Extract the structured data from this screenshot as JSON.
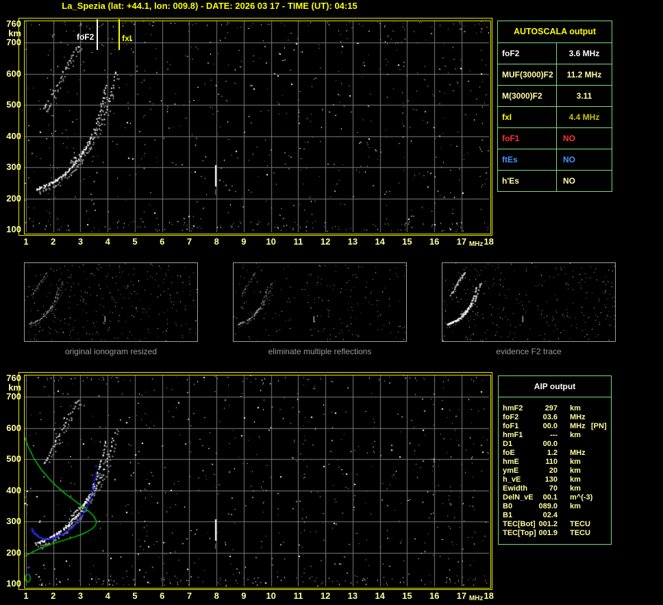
{
  "header": {
    "title": "La_Spezia (lat: +44.1, lon: 009.8) - DATE: 2026 03 17 - TIME (UT): 04:15"
  },
  "autoscala": {
    "title": "AUTOSCALA output",
    "border_color": "#7ede7e",
    "rows": [
      {
        "label": "foF2",
        "value": "3.6 MHz",
        "label_color": "#ffffff",
        "value_color": "#ffffff",
        "value_align": "center"
      },
      {
        "label": "MUF(3000)F2",
        "value": "11.2 MHz",
        "label_color": "#ffffa0",
        "value_color": "#ffffa0",
        "value_align": "center"
      },
      {
        "label": "M(3000)F2",
        "value": "3.11",
        "label_color": "#ffffa0",
        "value_color": "#ffffa0",
        "value_align": "center"
      },
      {
        "label": "fxI",
        "value": "4.4 MHz",
        "label_color": "#ffff00",
        "value_color": "#c9c400",
        "value_align": "center"
      },
      {
        "label": "foF1",
        "value": "NO",
        "label_color": "#ff3232",
        "value_color": "#ff3232",
        "value_align": "left"
      },
      {
        "label": "ftEs",
        "value": "NO",
        "label_color": "#4795ff",
        "value_color": "#4795ff",
        "value_align": "left"
      },
      {
        "label": "h'Es",
        "value": "NO",
        "label_color": "#ffffa0",
        "value_color": "#ffffa0",
        "value_align": "left"
      }
    ]
  },
  "aip": {
    "title": "AIP output",
    "text_color": "#ffffa0",
    "rows": [
      {
        "name": "hmF2",
        "value": "297",
        "unit": "km",
        "note": ""
      },
      {
        "name": "foF2",
        "value": "03.6",
        "unit": "MHz",
        "note": ""
      },
      {
        "name": "foF1",
        "value": "00.0",
        "unit": "MHz",
        "note": "[PN]"
      },
      {
        "name": "hmF1",
        "value": "---",
        "unit": "km",
        "note": ""
      },
      {
        "name": "D1",
        "value": "00.0",
        "unit": "",
        "note": ""
      },
      {
        "name": "foE",
        "value": "1.2",
        "unit": "MHz",
        "note": ""
      },
      {
        "name": "hmE",
        "value": "110",
        "unit": "km",
        "note": ""
      },
      {
        "name": "ymE",
        "value": "20",
        "unit": "km",
        "note": ""
      },
      {
        "name": "h_vE",
        "value": "130",
        "unit": "km",
        "note": ""
      },
      {
        "name": "Ewidth",
        "value": "70",
        "unit": "km",
        "note": ""
      },
      {
        "name": "DelN_vE",
        "value": "00.1",
        "unit": "m^(-3)",
        "note": ""
      },
      {
        "name": "B0",
        "value": "089.0",
        "unit": "km",
        "note": ""
      },
      {
        "name": "B1",
        "value": "02.4",
        "unit": "",
        "note": ""
      },
      {
        "name": "TEC[Bot]",
        "value": "001.2",
        "unit": "TECU",
        "note": ""
      },
      {
        "name": "TEC[Top]",
        "value": "001.9",
        "unit": "TECU",
        "note": ""
      }
    ]
  },
  "thumbnails": [
    {
      "caption": "original ionogram resized"
    },
    {
      "caption": "eliminate multiple reflections"
    },
    {
      "caption": "evidence F2 trace"
    }
  ],
  "chart_data": [
    {
      "id": "top_ionogram",
      "type": "scatter",
      "xlabel": "MHz",
      "ylabel": "km",
      "xlim": [
        1,
        18
      ],
      "ylim": [
        100,
        760
      ],
      "grid": true,
      "xticks": [
        1,
        2,
        3,
        4,
        5,
        6,
        7,
        8,
        9,
        10,
        11,
        12,
        13,
        14,
        15,
        16,
        17,
        18
      ],
      "yticks": [
        760,
        700,
        600,
        500,
        400,
        300,
        200,
        100
      ],
      "markers": [
        {
          "label": "foF2",
          "freq_mhz": 3.6,
          "color": "#ffffff",
          "label_side": "left"
        },
        {
          "label": "fxI",
          "freq_mhz": 4.4,
          "color": "#ffff00",
          "label_side": "right"
        }
      ],
      "series": [
        {
          "name": "F2-trace-ordinary",
          "style": "trace",
          "color": "#ffffff",
          "points": [
            [
              1.35,
              230
            ],
            [
              1.45,
              234
            ],
            [
              1.55,
              237
            ],
            [
              1.65,
              240
            ],
            [
              1.75,
              244
            ],
            [
              1.85,
              248
            ],
            [
              1.95,
              253
            ],
            [
              2.05,
              258
            ],
            [
              2.15,
              263
            ],
            [
              2.25,
              269
            ],
            [
              2.35,
              276
            ],
            [
              2.45,
              283
            ],
            [
              2.55,
              291
            ],
            [
              2.65,
              300
            ],
            [
              2.75,
              310
            ],
            [
              2.85,
              320
            ],
            [
              2.95,
              332
            ],
            [
              3.05,
              345
            ],
            [
              3.15,
              359
            ],
            [
              3.25,
              375
            ],
            [
              3.35,
              393
            ],
            [
              3.45,
              414
            ],
            [
              3.55,
              438
            ],
            [
              3.65,
              466
            ],
            [
              3.75,
              498
            ],
            [
              3.85,
              534
            ],
            [
              3.92,
              565
            ]
          ]
        },
        {
          "name": "F2-trace-extraordinary",
          "style": "trace",
          "color": "#e8e8e8",
          "points": [
            [
              2.6,
              318
            ],
            [
              2.8,
              332
            ],
            [
              3.0,
              348
            ],
            [
              3.2,
              367
            ],
            [
              3.4,
              390
            ],
            [
              3.6,
              418
            ],
            [
              3.8,
              452
            ],
            [
              3.95,
              490
            ],
            [
              4.1,
              532
            ],
            [
              4.2,
              575
            ],
            [
              4.3,
              612
            ]
          ]
        },
        {
          "name": "F2-second-hop",
          "style": "trace",
          "color": "#d8d8d8",
          "points": [
            [
              1.65,
              488
            ],
            [
              1.8,
              512
            ],
            [
              1.95,
              538
            ],
            [
              2.1,
              564
            ],
            [
              2.25,
              590
            ],
            [
              2.4,
              616
            ],
            [
              2.55,
              641
            ],
            [
              2.7,
              663
            ],
            [
              2.82,
              680
            ],
            [
              2.92,
              694
            ]
          ]
        },
        {
          "name": "interference-streak",
          "style": "vline",
          "color": "#ffffff",
          "points": [
            [
              7.95,
              238
            ],
            [
              7.95,
              307
            ]
          ]
        }
      ],
      "noise": {
        "seed": 11,
        "gray": 430,
        "white": 150,
        "top_band": 55,
        "bottom_band": 110,
        "columns": 7
      }
    },
    {
      "id": "bottom_ionogram",
      "type": "scatter",
      "xlabel": "MHz",
      "ylabel": "km",
      "xlim": [
        1,
        18
      ],
      "ylim": [
        100,
        760
      ],
      "grid": true,
      "xticks": [
        1,
        2,
        3,
        4,
        5,
        6,
        7,
        8,
        9,
        10,
        11,
        12,
        13,
        14,
        15,
        16,
        17,
        18
      ],
      "yticks": [
        760,
        700,
        600,
        500,
        400,
        300,
        200,
        100
      ],
      "markers": [],
      "series": [
        {
          "name": "F2-trace-ordinary",
          "style": "trace",
          "color": "#ffffff",
          "points": [
            [
              1.35,
              230
            ],
            [
              1.45,
              234
            ],
            [
              1.55,
              237
            ],
            [
              1.65,
              240
            ],
            [
              1.75,
              244
            ],
            [
              1.85,
              248
            ],
            [
              1.95,
              253
            ],
            [
              2.05,
              258
            ],
            [
              2.15,
              263
            ],
            [
              2.25,
              269
            ],
            [
              2.35,
              276
            ],
            [
              2.45,
              283
            ],
            [
              2.55,
              291
            ],
            [
              2.65,
              300
            ],
            [
              2.75,
              310
            ],
            [
              2.85,
              320
            ],
            [
              2.95,
              332
            ],
            [
              3.05,
              345
            ],
            [
              3.15,
              359
            ],
            [
              3.25,
              375
            ],
            [
              3.35,
              393
            ],
            [
              3.45,
              414
            ],
            [
              3.55,
              438
            ],
            [
              3.65,
              466
            ],
            [
              3.75,
              498
            ],
            [
              3.85,
              534
            ],
            [
              3.92,
              565
            ]
          ]
        },
        {
          "name": "F2-trace-extraordinary",
          "style": "trace",
          "color": "#e8e8e8",
          "points": [
            [
              2.6,
              318
            ],
            [
              2.8,
              332
            ],
            [
              3.0,
              348
            ],
            [
              3.2,
              367
            ],
            [
              3.4,
              390
            ],
            [
              3.6,
              418
            ],
            [
              3.8,
              452
            ],
            [
              3.95,
              490
            ],
            [
              4.1,
              532
            ],
            [
              4.2,
              575
            ],
            [
              4.3,
              612
            ]
          ]
        },
        {
          "name": "F2-second-hop",
          "style": "trace",
          "color": "#d8d8d8",
          "points": [
            [
              1.65,
              488
            ],
            [
              1.8,
              512
            ],
            [
              1.95,
              538
            ],
            [
              2.1,
              564
            ],
            [
              2.25,
              590
            ],
            [
              2.4,
              616
            ],
            [
              2.55,
              641
            ],
            [
              2.7,
              663
            ],
            [
              2.82,
              680
            ],
            [
              2.92,
              694
            ]
          ]
        },
        {
          "name": "interference-streak",
          "style": "vline",
          "color": "#ffffff",
          "points": [
            [
              7.95,
              238
            ],
            [
              7.95,
              307
            ]
          ]
        },
        {
          "name": "model-electron-density-profile",
          "style": "line",
          "color": "#00cc00",
          "points": [
            [
              0.95,
              570
            ],
            [
              1.1,
              536
            ],
            [
              1.3,
              501
            ],
            [
              1.55,
              468
            ],
            [
              1.85,
              437
            ],
            [
              2.15,
              411
            ],
            [
              2.45,
              389
            ],
            [
              2.75,
              369
            ],
            [
              3.05,
              350
            ],
            [
              3.3,
              333
            ],
            [
              3.48,
              318
            ],
            [
              3.6,
              299
            ],
            [
              3.54,
              286
            ],
            [
              3.42,
              276
            ],
            [
              3.25,
              267
            ],
            [
              3.05,
              259
            ],
            [
              2.8,
              251
            ],
            [
              2.55,
              244
            ],
            [
              2.25,
              236
            ],
            [
              1.95,
              228
            ],
            [
              1.65,
              218
            ],
            [
              1.4,
              209
            ],
            [
              1.2,
              200
            ],
            [
              1.05,
              193
            ],
            [
              0.95,
              188
            ]
          ]
        },
        {
          "name": "model-E-layer-loop",
          "style": "ellipse",
          "color": "#00cc00",
          "center": [
            1.06,
            118
          ],
          "rx": 0.1,
          "ry": 12,
          "points": []
        },
        {
          "name": "restored-F2-trace",
          "style": "dots",
          "color": "#2a2aee",
          "points": [
            [
              1.18,
              278
            ],
            [
              1.25,
              268
            ],
            [
              1.33,
              260
            ],
            [
              1.42,
              254
            ],
            [
              1.52,
              249
            ],
            [
              1.63,
              246
            ],
            [
              1.75,
              245
            ],
            [
              1.87,
              246
            ],
            [
              2.0,
              249
            ],
            [
              2.12,
              253
            ],
            [
              2.25,
              258
            ],
            [
              2.38,
              264
            ],
            [
              2.52,
              272
            ],
            [
              2.65,
              281
            ],
            [
              2.78,
              292
            ],
            [
              2.9,
              304
            ],
            [
              3.02,
              318
            ],
            [
              3.12,
              333
            ],
            [
              3.22,
              350
            ],
            [
              3.32,
              370
            ],
            [
              3.4,
              392
            ],
            [
              3.47,
              416
            ],
            [
              3.52,
              440
            ],
            [
              3.56,
              460
            ]
          ],
          "extra_points": [
            [
              3.58,
              478
            ],
            [
              1.07,
              152
            ],
            [
              1.1,
              130
            ]
          ]
        }
      ],
      "noise": {
        "seed": 29,
        "gray": 430,
        "white": 150,
        "top_band": 55,
        "bottom_band": 110,
        "columns": 7
      }
    }
  ],
  "thumb_chart": {
    "xlim": [
      1,
      16
    ],
    "ylim": [
      100,
      760
    ],
    "noise_seeds": [
      41,
      42,
      43
    ],
    "gray": [
      240,
      150,
      210
    ],
    "white": [
      60,
      45,
      70
    ]
  }
}
